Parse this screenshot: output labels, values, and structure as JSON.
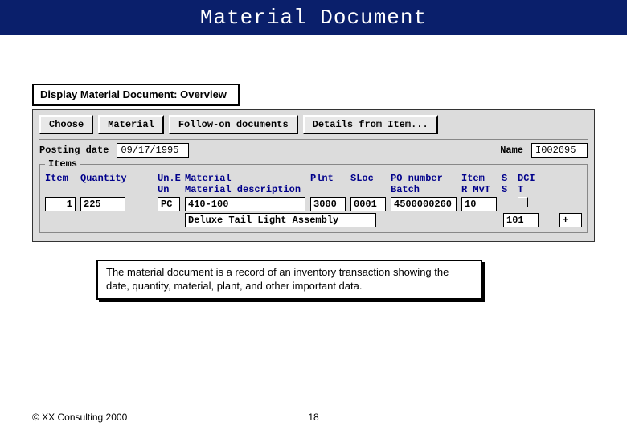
{
  "slide": {
    "title": "Material Document",
    "copyright": "© XX Consulting 2000",
    "page": "18"
  },
  "window": {
    "title": "Display Material Document:  Overview"
  },
  "toolbar": {
    "choose": "Choose",
    "material": "Material",
    "followon": "Follow-on documents",
    "details": "Details from Item..."
  },
  "header": {
    "posting_date_label": "Posting date",
    "posting_date": "09/17/1995",
    "name_label": "Name",
    "name": "I002695"
  },
  "items": {
    "group_label": "Items",
    "cols": {
      "item": "Item",
      "quantity": "Quantity",
      "une": "Un.E",
      "un": "Un",
      "material": "Material",
      "material_desc": "Material description",
      "plnt": "Plnt",
      "sloc": "SLoc",
      "po": "PO number",
      "batch": "Batch",
      "item2": "Item",
      "r": "R",
      "mvt": "MvT",
      "s": "S",
      "s2": "S",
      "dci": "DCI",
      "t": "T"
    },
    "row": {
      "item": "1",
      "qty": "225",
      "un": "PC",
      "material": "410-100",
      "plnt": "3000",
      "sloc": "0001",
      "po": "4500000260",
      "item2": "10",
      "desc": "Deluxe Tail Light Assembly",
      "mvt": "101",
      "dci": "+"
    }
  },
  "callout": {
    "text": "The material document is a record of an inventory transaction showing the date, quantity, material, plant, and other important data."
  }
}
